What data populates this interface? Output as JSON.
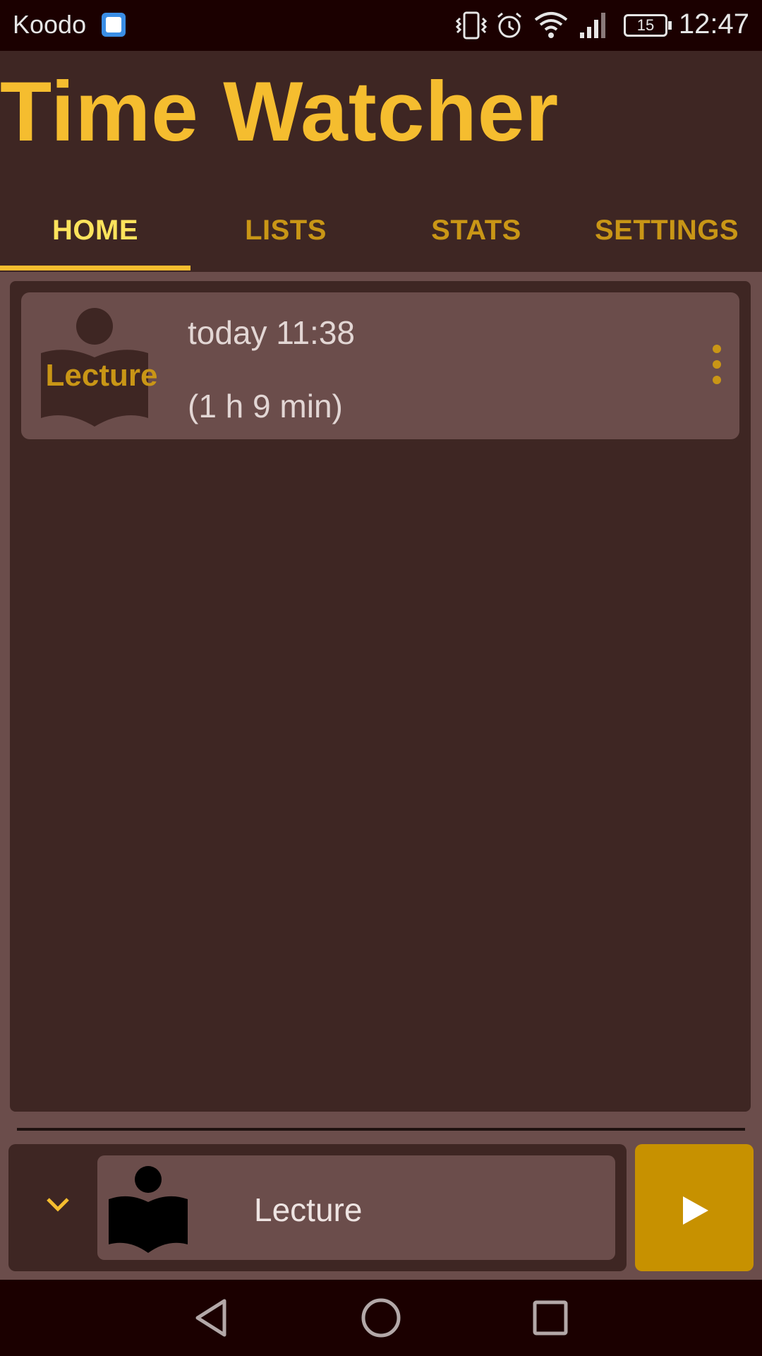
{
  "status_bar": {
    "carrier": "Koodo",
    "battery": "15",
    "time": "12:47"
  },
  "app": {
    "title": "Time Watcher",
    "accent": "#f5bd2f"
  },
  "tabs": [
    {
      "label": "HOME",
      "active": true
    },
    {
      "label": "LISTS",
      "active": false
    },
    {
      "label": "STATS",
      "active": false
    },
    {
      "label": "SETTINGS",
      "active": false
    }
  ],
  "entries": [
    {
      "activity": "Lecture",
      "icon": "book-reader-icon",
      "time": "today 11:38",
      "duration": "(1 h 9 min)"
    }
  ],
  "selector": {
    "activity": "Lecture",
    "icon": "book-reader-icon",
    "play_color": "#c79100"
  }
}
